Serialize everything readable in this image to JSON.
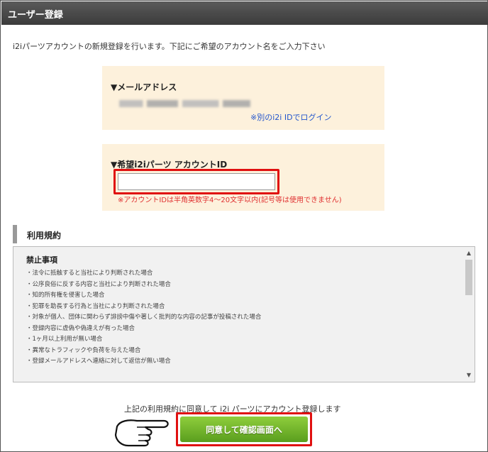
{
  "header": {
    "title": "ユーザー登録"
  },
  "intro": "i2iパーツアカウントの新規登録を行います。下記にご希望のアカウント名をご入力下さい",
  "email_section": {
    "label": "▼メールアドレス",
    "other_login_link": "※別のi2i IDでログイン"
  },
  "account_id_section": {
    "label": "▼希望i2iパーツ アカウントID",
    "input_value": "",
    "note": "※アカウントIDは半角英数字4～20文字以内(記号等は使用できません)"
  },
  "terms": {
    "section_title": "利用規約",
    "heading": "禁止事項",
    "items": [
      "・法令に抵触すると当社により判断された場合",
      "・公序良俗に反する内容と当社により判断された場合",
      "・知的所有権を侵害した場合",
      "・犯罪を助長する行為と当社により判断された場合",
      "・対象が個人、団体に関わらず誹謗中傷や著しく批判的な内容の記事が投稿された場合",
      "・登録内容に虚偽や偽違えが有った場合",
      "・1ヶ月以上利用が無い場合",
      "・異常なトラフィックや負荷を与えた場合",
      "・登録メールアドレスへ連絡に対して返信が無い場合"
    ],
    "scroll": {
      "up": "▲",
      "down": "▼"
    }
  },
  "footer": {
    "agree_text": "上記の利用規約に同意して i2i パーツにアカウント登録します",
    "confirm_button": "同意して確認画面へ"
  },
  "colors": {
    "highlight": "#e01010",
    "panel_bg": "#fdf1dc",
    "button_green": "#6cb52a",
    "link": "#2255cc",
    "note_red": "#e03030"
  }
}
